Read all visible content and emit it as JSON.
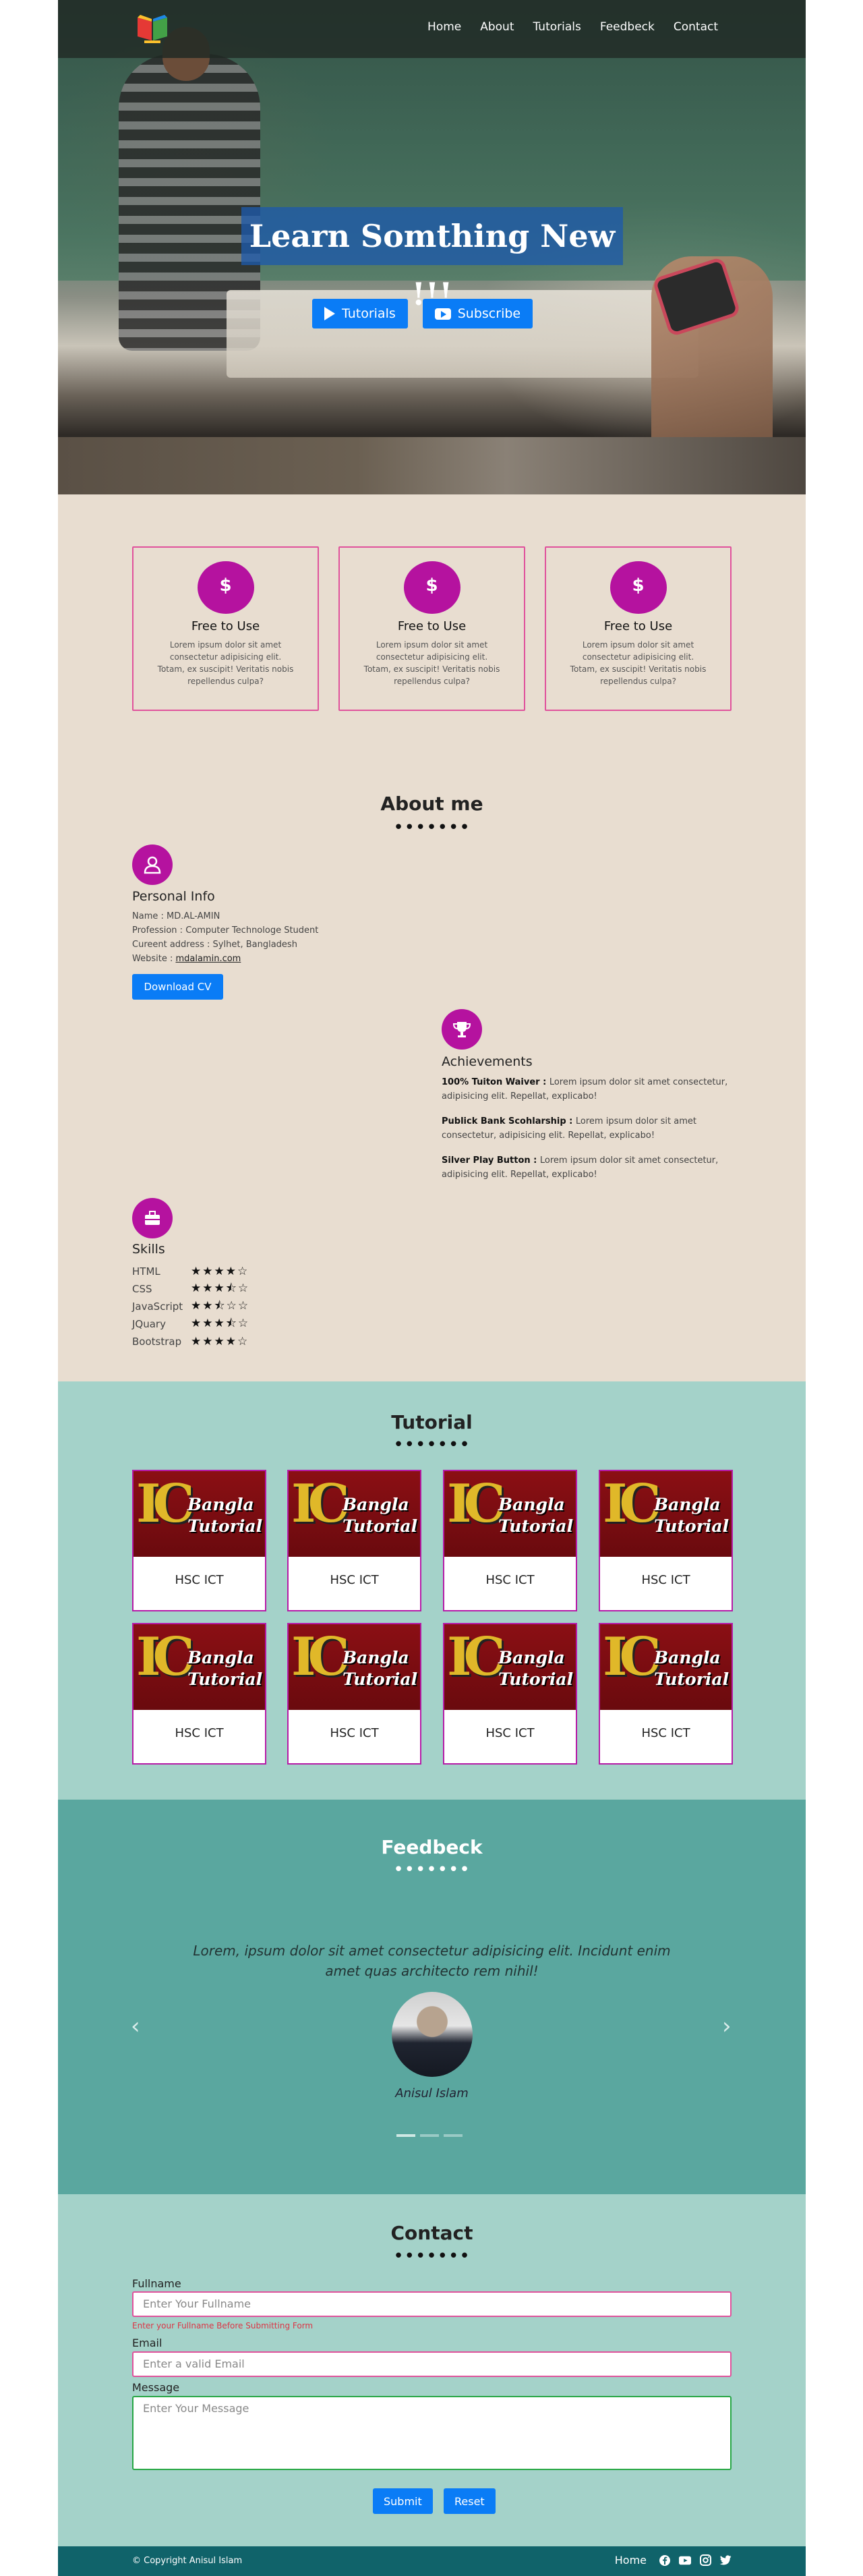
{
  "nav": {
    "logo_icon": "book-logo-icon",
    "links": [
      "Home",
      "About",
      "Tutorials",
      "Feedbeck",
      "Contact"
    ]
  },
  "hero": {
    "title": "Learn Somthing New !!!",
    "btn_tutorials": "Tutorials",
    "btn_subscribe": "Subscribe"
  },
  "features": [
    {
      "icon": "dollar-hand-icon",
      "title": "Free to Use",
      "text": "Lorem ipsum dolor sit amet consectetur adipisicing elit. Totam, ex suscipit! Veritatis nobis repellendus culpa?"
    },
    {
      "icon": "dollar-hand-icon",
      "title": "Free to Use",
      "text": "Lorem ipsum dolor sit amet consectetur adipisicing elit. Totam, ex suscipit! Veritatis nobis repellendus culpa?"
    },
    {
      "icon": "dollar-hand-icon",
      "title": "Free to Use",
      "text": "Lorem ipsum dolor sit amet consectetur adipisicing elit. Totam, ex suscipit! Veritatis nobis repellendus culpa?"
    }
  ],
  "about": {
    "title": "About me",
    "dots": "•••••••",
    "personal_title": "Personal Info",
    "name": "Name : MD.AL-AMIN",
    "profession": "Profession : Computer Technologe Student",
    "address": "Cureent address : Sylhet, Bangladesh",
    "website_prefix": "Website : ",
    "website": "mdalamin.com",
    "btn_cv": "Download CV",
    "achievements_title": "Achievements",
    "achievements": [
      {
        "bold": "100% Tuiton Waiver : ",
        "text": "Lorem ipsum dolor sit amet consectetur, adipisicing elit. Repellat, explicabo!"
      },
      {
        "bold": "Publick Bank Scohlarship : ",
        "text": "Lorem ipsum dolor sit amet consectetur, adipisicing elit. Repellat, explicabo!"
      },
      {
        "bold": "Silver Play Button : ",
        "text": "Lorem ipsum dolor sit amet consectetur, adipisicing elit. Repellat, explicabo!"
      }
    ],
    "skills_title": "Skills",
    "skills": [
      {
        "name": "HTML",
        "rating": 4
      },
      {
        "name": "CSS",
        "rating": 3.5
      },
      {
        "name": "JavaScript",
        "rating": 2.5
      },
      {
        "name": "JQuary",
        "rating": 3.5
      },
      {
        "name": "Bootstrap",
        "rating": 4
      }
    ]
  },
  "tutorial": {
    "title": "Tutorial",
    "dots": "•••••••",
    "thumb_mark": "IC",
    "thumb_line1": "Bangla",
    "thumb_line2": "Tutorial",
    "cards": [
      "HSC ICT",
      "HSC ICT",
      "HSC ICT",
      "HSC ICT",
      "HSC ICT",
      "HSC ICT",
      "HSC ICT",
      "HSC ICT"
    ]
  },
  "feedback": {
    "title": "Feedbeck",
    "dots": "•••••••",
    "quote": "Lorem, ipsum dolor sit amet consectetur adipisicing elit. Incidunt enim amet quas architecto rem nihil!",
    "name": "Anisul Islam",
    "prev": "‹",
    "next": "›",
    "active_slide": 1,
    "slide_count": 3
  },
  "contact": {
    "title": "Contact",
    "dots": "•••••••",
    "fullname_label": "Fullname",
    "fullname_placeholder": "Enter Your Fullname",
    "fullname_error": "Enter your Fullname Before Submitting Form",
    "email_label": "Email",
    "email_placeholder": "Enter a valid Email",
    "message_label": "Message",
    "message_placeholder": "Enter Your Message",
    "btn_submit": "Submit",
    "btn_reset": "Reset"
  },
  "footer": {
    "copyright": "© Copyright Anisul Islam",
    "home": "Home",
    "icons": [
      "facebook-icon",
      "youtube-icon",
      "instagram-icon",
      "twitter-icon"
    ]
  },
  "colors": {
    "accent": "#0a7cf6",
    "magenta": "#b5129f",
    "beige": "#e8ddd0",
    "teal_light": "#a4d2c9",
    "teal_dark": "#5aa79f",
    "footer": "#10636a"
  }
}
